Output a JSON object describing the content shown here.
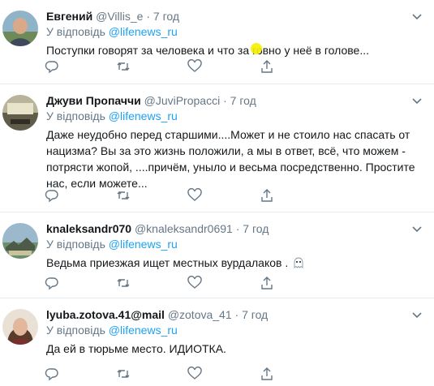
{
  "tweets": [
    {
      "name": "Евгений",
      "handle": "@Villis_e",
      "sep": "·",
      "time": "7 год",
      "reply_prefix": "У відповідь",
      "reply_to": "@lifenews_ru",
      "text": "Поступки говорят за человека и что за говно у неё в голове..."
    },
    {
      "name": "Джуви Пропаччи",
      "handle": "@JuviPropacci",
      "sep": "·",
      "time": "7 год",
      "reply_prefix": "У відповідь",
      "reply_to": "@lifenews_ru",
      "text": "Даже неудобно перед старшими....Может и не стоило нас спасать от нацизма? Вы за это жизнь положили, а мы в ответ, всё, что можем - потрясти жопой, ....причём, уныло и весьма посредственно. Простите нас, если можете..."
    },
    {
      "name": "knaleksandr070",
      "handle": "@knaleksandr0691",
      "sep": "·",
      "time": "7 год",
      "reply_prefix": "У відповідь",
      "reply_to": "@lifenews_ru",
      "text": "Ведьма приезжая ищет местных вурдалаков ."
    },
    {
      "name": "lyuba.zotova.41@mail",
      "handle": "@zotova_41",
      "sep": "·",
      "time": "7 год",
      "reply_prefix": "У відповідь",
      "reply_to": "@lifenews_ru",
      "text": "Да ей в тюрьме место.  ИДИОТКА."
    }
  ],
  "icons": {
    "reply": "reply-icon",
    "retweet": "retweet-icon",
    "like": "heart-icon",
    "share": "share-icon",
    "more": "chevron-down-icon"
  },
  "colors": {
    "accent": "#1da1f2",
    "muted": "#657786",
    "text": "#14171a",
    "divider": "#e6ecf0",
    "cursor_highlight": "#f5f000"
  }
}
